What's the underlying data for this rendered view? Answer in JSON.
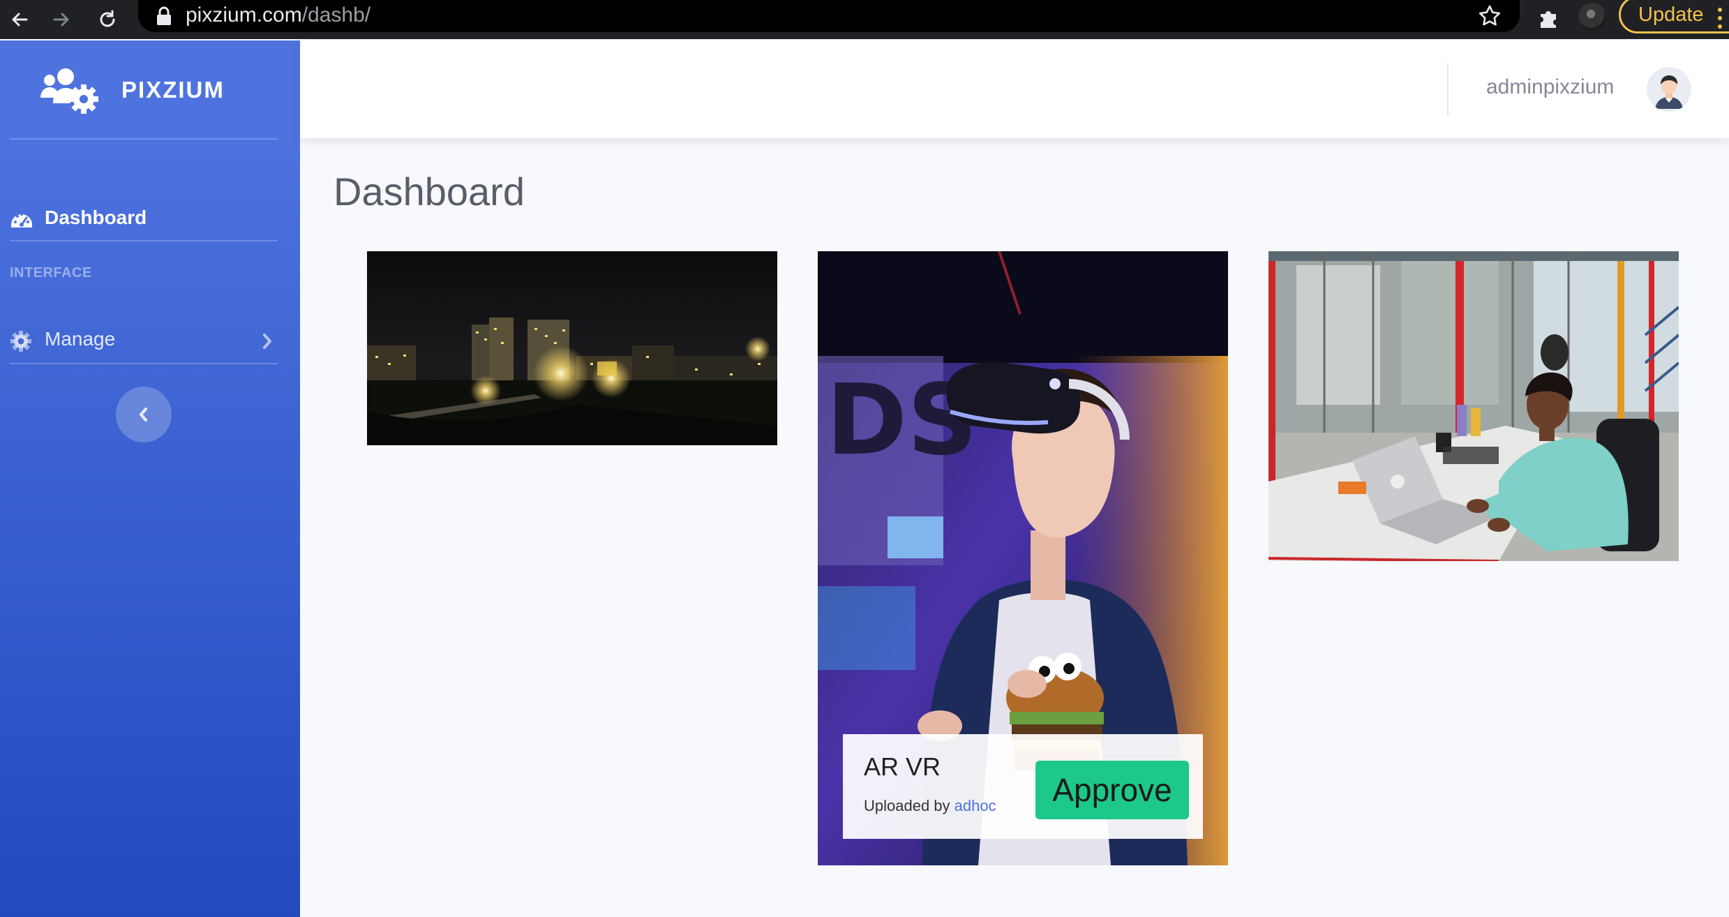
{
  "browser": {
    "url_host": "pixzium.com",
    "url_path": "/dashb/",
    "update_label": "Update"
  },
  "sidebar": {
    "brand": "PIXZIUM",
    "items": [
      {
        "label": "Dashboard",
        "icon": "tachometer-icon",
        "active": true
      },
      {
        "label": "Manage",
        "icon": "gear-icon",
        "active": false
      }
    ],
    "heading": "INTERFACE"
  },
  "topbar": {
    "username": "adminpixzium"
  },
  "page": {
    "title": "Dashboard"
  },
  "gallery": [
    {
      "scene": "night city skyline"
    },
    {
      "scene": "person wearing VR headset",
      "caption": {
        "title": "AR VR",
        "uploaded_prefix": "Uploaded by",
        "uploader": "adhoc",
        "action": "Approve"
      }
    },
    {
      "scene": "man working on laptop in office"
    }
  ],
  "colors": {
    "sidebar_start": "#4e73df",
    "sidebar_end": "#224abe",
    "approve": "#1cc88a",
    "link": "#4e73df",
    "update": "#f2c14e"
  }
}
